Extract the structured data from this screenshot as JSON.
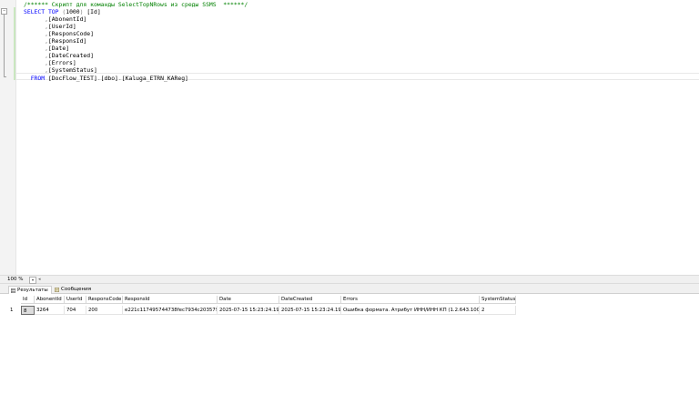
{
  "editor": {
    "lines": [
      [
        {
          "t": "/****** Скрипт для команды SelectTopNRows из среды SSMS  ******/",
          "c": "cm"
        }
      ],
      [
        {
          "t": "SELECT",
          "c": "kw"
        },
        {
          "t": " ",
          "c": "id"
        },
        {
          "t": "TOP",
          "c": "kw"
        },
        {
          "t": " ",
          "c": "id"
        },
        {
          "t": "(",
          "c": "gr"
        },
        {
          "t": "1000",
          "c": "id"
        },
        {
          "t": ")",
          "c": "gr"
        },
        {
          "t": " [Id]",
          "c": "id"
        }
      ],
      [
        {
          "t": "      ",
          "c": "id"
        },
        {
          "t": ",",
          "c": "gr"
        },
        {
          "t": "[AbonentId]",
          "c": "id"
        }
      ],
      [
        {
          "t": "      ",
          "c": "id"
        },
        {
          "t": ",",
          "c": "gr"
        },
        {
          "t": "[UserId]",
          "c": "id"
        }
      ],
      [
        {
          "t": "      ",
          "c": "id"
        },
        {
          "t": ",",
          "c": "gr"
        },
        {
          "t": "[ResponsCode]",
          "c": "id"
        }
      ],
      [
        {
          "t": "      ",
          "c": "id"
        },
        {
          "t": ",",
          "c": "gr"
        },
        {
          "t": "[ResponsId]",
          "c": "id"
        }
      ],
      [
        {
          "t": "      ",
          "c": "id"
        },
        {
          "t": ",",
          "c": "gr"
        },
        {
          "t": "[Date]",
          "c": "id"
        }
      ],
      [
        {
          "t": "      ",
          "c": "id"
        },
        {
          "t": ",",
          "c": "gr"
        },
        {
          "t": "[DateCreated]",
          "c": "id"
        }
      ],
      [
        {
          "t": "      ",
          "c": "id"
        },
        {
          "t": ",",
          "c": "gr"
        },
        {
          "t": "[Errors]",
          "c": "id"
        }
      ],
      [
        {
          "t": "      ",
          "c": "id"
        },
        {
          "t": ",",
          "c": "gr"
        },
        {
          "t": "[SystemStatus]",
          "c": "id"
        }
      ],
      [
        {
          "t": "  ",
          "c": "id"
        },
        {
          "t": "FROM",
          "c": "kw"
        },
        {
          "t": " [DocFlow_TEST]",
          "c": "id"
        },
        {
          "t": ".",
          "c": "gr"
        },
        {
          "t": "[dbo]",
          "c": "id"
        },
        {
          "t": ".",
          "c": "gr"
        },
        {
          "t": "[Kaluga_ETRN_KAReg]",
          "c": "id"
        }
      ]
    ]
  },
  "status": {
    "zoom": "100 %",
    "zoom_arrow": "▾",
    "scroll_left": "◂"
  },
  "tabs": {
    "results": "Результаты",
    "messages": "Сообщения"
  },
  "grid": {
    "columns": [
      "Id",
      "AbonentId",
      "UserId",
      "ResponsCode",
      "ResponsId",
      "Date",
      "DateCreated",
      "Errors",
      "SystemStatus"
    ],
    "rows": [
      {
        "num": "1",
        "cells": [
          "8",
          "3264",
          "704",
          "200",
          "e221c117495744738fec7934c203579",
          "2025-07-15 15:23:24.197",
          "2025-07-15 15:23:24.197",
          "Ошибка формата. Атрибут ИНН/ИНН КП (1.2.643.100...",
          "2"
        ]
      }
    ]
  }
}
